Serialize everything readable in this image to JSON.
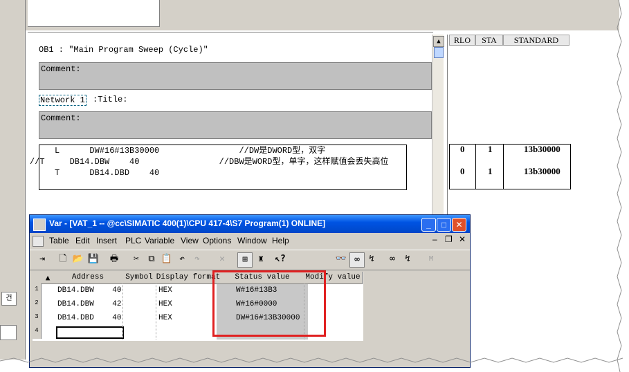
{
  "editor": {
    "block_title": "OB1 :  \"Main Program Sweep (Cycle)\"",
    "comment1": "Comment:",
    "network_label": "Network 1",
    "network_title": ":Title:",
    "comment2": "Comment:",
    "code_lines": [
      "     L      DW#16#13B30000                //DW是DWORD型，双字",
      "//T     DB14.DBW    40                //DBW是WORD型，单字，这样赋值会丢失高位",
      "     T      DB14.DBD    40"
    ]
  },
  "status_panel": {
    "headers": [
      "RLO",
      "STA",
      "STANDARD"
    ],
    "rows": [
      {
        "rlo": "0",
        "sta": "1",
        "standard": "13b30000"
      },
      {
        "rlo": "0",
        "sta": "1",
        "standard": "13b30000"
      }
    ]
  },
  "vat": {
    "title": "Var - [VAT_1 -- @cc\\SIMATIC 400(1)\\CPU 417-4\\S7 Program(1)  ONLINE]",
    "menu": [
      "Table",
      "Edit",
      "Insert",
      "PLC",
      "Variable",
      "View",
      "Options",
      "Window",
      "Help"
    ],
    "columns": [
      "Address",
      "Symbol",
      "Display format",
      "Status value",
      "Modify value"
    ],
    "rows": [
      {
        "no": "1",
        "address": "DB14.DBW    40",
        "symbol": "",
        "format": "HEX",
        "status": "W#16#13B3",
        "modify": ""
      },
      {
        "no": "2",
        "address": "DB14.DBW    42",
        "symbol": "",
        "format": "HEX",
        "status": "W#16#0000",
        "modify": ""
      },
      {
        "no": "3",
        "address": "DB14.DBD    40",
        "symbol": "",
        "format": "HEX",
        "status": "DW#16#13B30000",
        "modify": ""
      },
      {
        "no": "4",
        "address": "",
        "symbol": "",
        "format": "",
        "status": "",
        "modify": ""
      }
    ],
    "highlight_color": "#e02020"
  },
  "left_panel": {
    "label": "건"
  }
}
